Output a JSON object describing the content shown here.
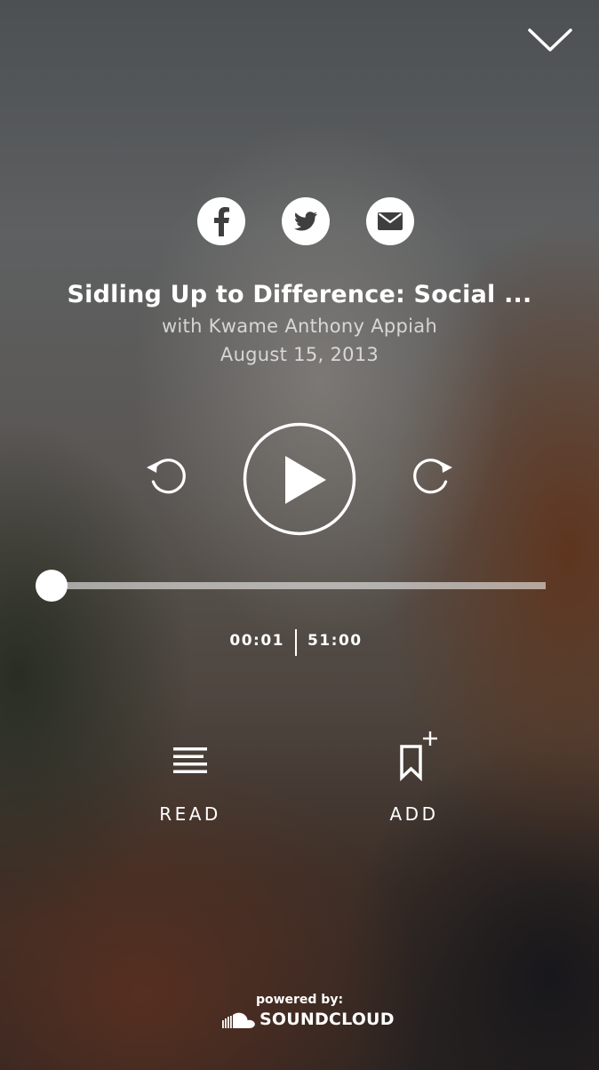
{
  "header": {
    "close_icon": "chevron-down-icon"
  },
  "share": {
    "facebook_icon": "facebook-icon",
    "twitter_icon": "twitter-icon",
    "email_icon": "email-icon"
  },
  "episode": {
    "title": "Sidling Up to Difference: Social ...",
    "subtitle": "with Kwame Anthony Appiah",
    "date": "August 15, 2013"
  },
  "player": {
    "current_time": "00:01",
    "total_time": "51:00",
    "progress_fraction": 0.0003,
    "rewind_icon": "rewind-icon",
    "play_icon": "play-icon",
    "forward_icon": "forward-icon"
  },
  "actions": {
    "read_label": "READ",
    "add_label": "ADD",
    "read_icon": "read-icon",
    "add_icon": "bookmark-add-icon"
  },
  "footer": {
    "powered_by": "powered by:",
    "brand": "SOUNDCLOUD",
    "brand_icon": "soundcloud-icon"
  },
  "colors": {
    "foreground": "#ffffff",
    "track": "rgba(255,255,255,0.55)"
  }
}
